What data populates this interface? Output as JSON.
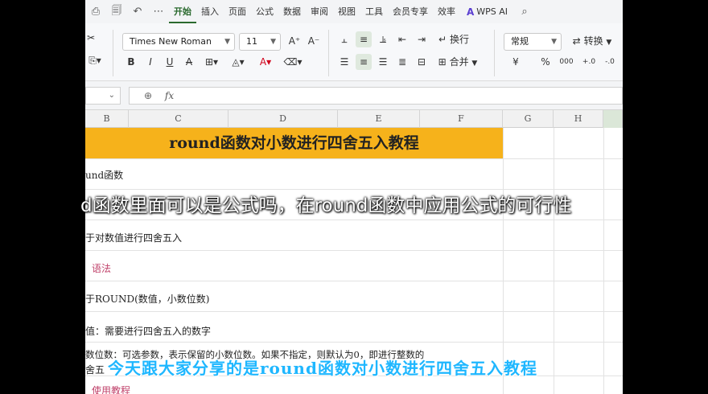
{
  "menu": {
    "quick_icons": [
      "print-icon",
      "print-preview-icon",
      "undo-icon",
      "more-icon"
    ],
    "tabs": [
      "开始",
      "插入",
      "页面",
      "公式",
      "数据",
      "审阅",
      "视图",
      "工具",
      "会员专享",
      "效率"
    ],
    "active_tab": "开始",
    "ai_label": "WPS AI"
  },
  "ribbon": {
    "font_name": "Times New Roman",
    "font_size": "11",
    "wrap_label": "换行",
    "merge_label": "合并",
    "number_format": "常规",
    "convert_label": "转换",
    "bold": "B",
    "italic": "I",
    "underline": "U",
    "strike": "A",
    "grow_font": "A⁺",
    "shrink_font": "A⁻",
    "currency": "¥",
    "percent": "%",
    "thousands": "000",
    "inc_decimal": "+.0",
    "dec_decimal": "-.0",
    "accent_color": "#2b6a2f"
  },
  "formula_bar": {
    "fx_label": "fx",
    "value": ""
  },
  "columns": [
    "B",
    "C",
    "D",
    "E",
    "F",
    "G",
    "H"
  ],
  "sheet": {
    "title": "round函数对小数进行四舍五入教程",
    "rows": [
      {
        "text": "und函数",
        "style": "normal"
      },
      {
        "text": "",
        "style": "normal"
      },
      {
        "text": "于对数值进行四舍五入",
        "style": "normal"
      },
      {
        "text": "语法",
        "style": "pink"
      },
      {
        "text": "于ROUND(数值，小数位数)",
        "style": "normal"
      },
      {
        "text": "值：需要进行四舍五入的数字",
        "style": "normal"
      },
      {
        "text": "数位数：可选参数，表示保留的小数位数。如果不指定，则默认为0，即进行整数的",
        "style": "normal"
      },
      {
        "text": "舍五",
        "style": "normal"
      },
      {
        "text": "使用教程",
        "style": "pink"
      }
    ]
  },
  "overlay": {
    "subtitle_top": "d函数里面可以是公式吗，在round函数中应用公式的可行性",
    "subtitle_bottom": "今天跟大家分享的是round函数对小数进行四舍五入教程"
  }
}
